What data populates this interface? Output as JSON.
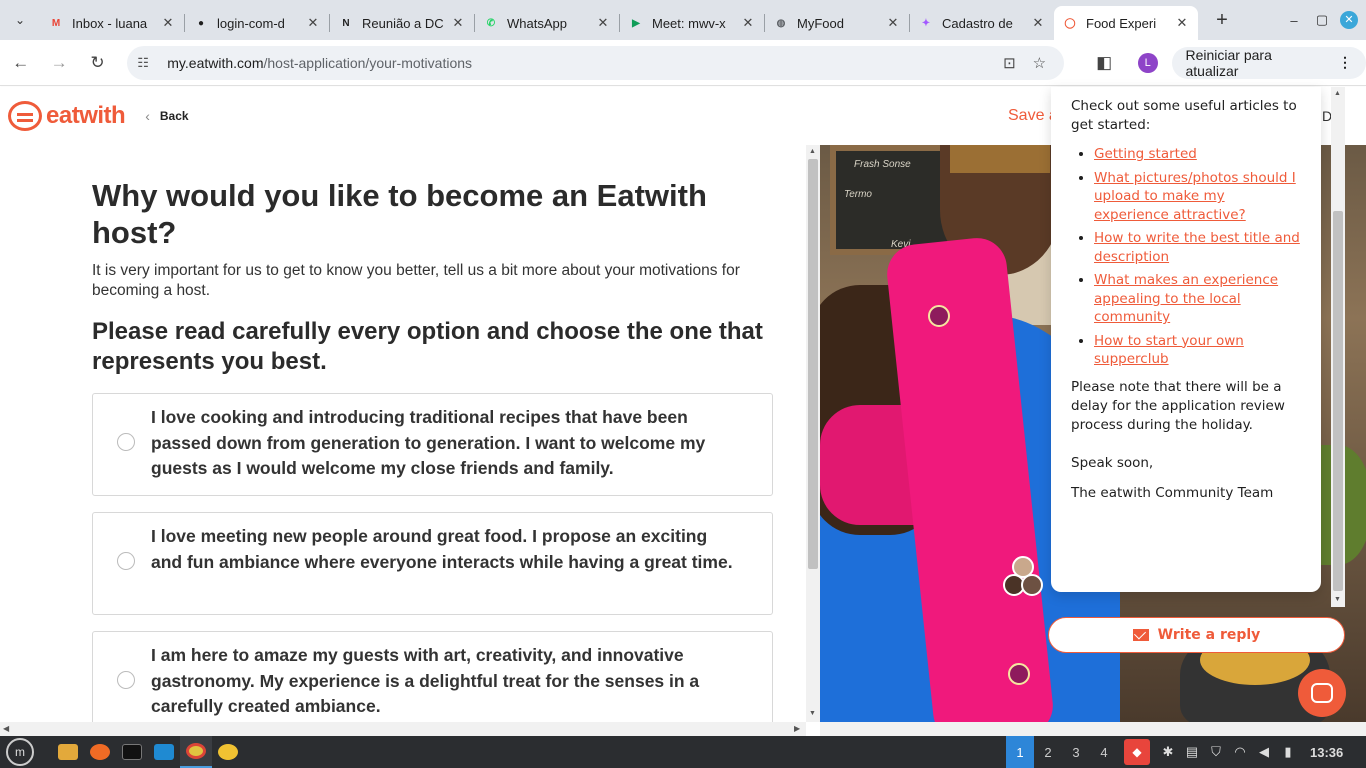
{
  "browser": {
    "tabs": [
      {
        "title": "Inbox - luana",
        "favicon": "gmail-icon",
        "color": "#ea4335",
        "glyph": "M"
      },
      {
        "title": "login-com-d",
        "favicon": "github-icon",
        "color": "#1f1f1f",
        "glyph": "●"
      },
      {
        "title": "Reunião a DC",
        "favicon": "notion-icon",
        "color": "#222222",
        "glyph": "N"
      },
      {
        "title": "WhatsApp",
        "favicon": "whatsapp-icon",
        "color": "#25d366",
        "glyph": "✆"
      },
      {
        "title": "Meet: mwv-x",
        "favicon": "meet-icon",
        "color": "#0f9d58",
        "glyph": "▶"
      },
      {
        "title": "MyFood",
        "favicon": "globe-icon",
        "color": "#5f6368",
        "glyph": "◍"
      },
      {
        "title": "Cadastro de",
        "favicon": "figma-icon",
        "color": "#a259ff",
        "glyph": "✦"
      },
      {
        "title": "Food Experi",
        "favicon": "eatwith-icon",
        "color": "#ef5b3a",
        "glyph": "◯",
        "active": true
      }
    ],
    "address": {
      "domain": "my.eatwith.com",
      "path": "/host-application/your-motivations"
    },
    "profile_initial": "L",
    "update_label": "Reiniciar para atualizar"
  },
  "site": {
    "logo_text": "eatwith",
    "back_label": "Back",
    "save_label": "Save a",
    "header_right": "D"
  },
  "form": {
    "title": "Why would you like to become an Eatwith host?",
    "intro": "It is very important for us to get to know you better, tell us a bit more about your motivations for becoming a host.",
    "subtitle": "Please read carefully every option and choose the one that represents you best.",
    "options": [
      {
        "label": "I love cooking and introducing traditional recipes that have been passed down from generation to generation. I want to welcome my guests as I would welcome my close friends and family."
      },
      {
        "label": "I love meeting new people around great food. I propose an exciting and fun ambiance where everyone interacts while having a great time."
      },
      {
        "label": "I am here to amaze my guests with art, creativity, and innovative gastronomy. My experience is a delightful treat for the senses in a carefully created ambiance."
      }
    ]
  },
  "chat": {
    "intro": "Check out some useful articles to get started:",
    "links": [
      "Getting started",
      "What pictures/photos should I upload to make my experience attractive?",
      "How to write the best title and description",
      "What makes an experience appealing to the local community",
      "How to start your own supperclub"
    ],
    "note": "Please note that there will be a delay for the application review process during the holiday.",
    "signoff": "Speak soon,",
    "signature": "The eatwith Community Team",
    "reply_label": "Write a reply",
    "accent": "#ef5b3a"
  },
  "photo": {
    "board_lines": [
      "Frash Sonse",
      "Termo",
      "Kevi"
    ]
  },
  "taskbar": {
    "workspaces": [
      "1",
      "2",
      "3",
      "4"
    ],
    "current_workspace": "1",
    "clock": "13:36"
  }
}
